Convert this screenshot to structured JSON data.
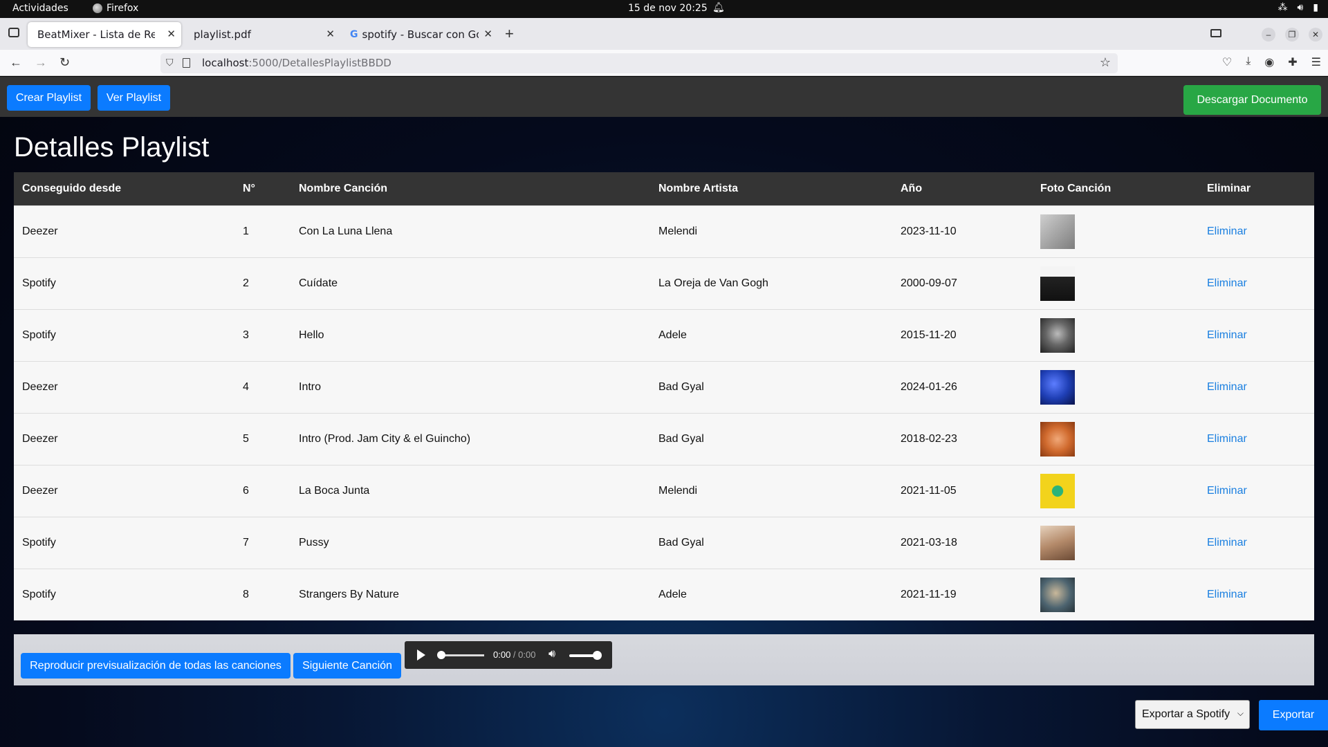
{
  "system_bar": {
    "activities": "Actividades",
    "app": "Firefox",
    "clock": "15 de nov  20:25"
  },
  "browser": {
    "tabs": [
      {
        "title": "BeatMixer - Lista de Reproducción",
        "active": true
      },
      {
        "title": "playlist.pdf",
        "active": false
      },
      {
        "title": "spotify - Buscar con Google",
        "active": false
      }
    ],
    "url_host": "localhost",
    "url_path": ":5000/DetallesPlaylistBBDD"
  },
  "header": {
    "create_label": "Crear Playlist",
    "view_label": "Ver Playlist",
    "download_label": "Descargar Documento"
  },
  "page": {
    "title": "Detalles Playlist"
  },
  "table": {
    "columns": [
      "Conseguido desde",
      "N°",
      "Nombre Canción",
      "Nombre Artista",
      "Año",
      "Foto Canción",
      "Eliminar"
    ],
    "rows": [
      {
        "source": "Deezer",
        "n": "1",
        "song": "Con La Luna Llena",
        "artist": "Melendi",
        "date": "2023-11-10",
        "action": "Eliminar",
        "thumb": "#9a9a9a"
      },
      {
        "source": "Spotify",
        "n": "2",
        "song": "Cuídate",
        "artist": "La Oreja de Van Gogh",
        "date": "2000-09-07",
        "action": "Eliminar",
        "thumb": "#2a2a2a"
      },
      {
        "source": "Spotify",
        "n": "3",
        "song": "Hello",
        "artist": "Adele",
        "date": "2015-11-20",
        "action": "Eliminar",
        "thumb": "#5a5a5a"
      },
      {
        "source": "Deezer",
        "n": "4",
        "song": "Intro",
        "artist": "Bad Gyal",
        "date": "2024-01-26",
        "action": "Eliminar",
        "thumb": "#1f3fb5"
      },
      {
        "source": "Deezer",
        "n": "5",
        "song": "Intro (Prod. Jam City & el Guincho)",
        "artist": "Bad Gyal",
        "date": "2018-02-23",
        "action": "Eliminar",
        "thumb": "#d06a2e"
      },
      {
        "source": "Deezer",
        "n": "6",
        "song": "La Boca Junta",
        "artist": "Melendi",
        "date": "2021-11-05",
        "action": "Eliminar",
        "thumb": "#f2d31c"
      },
      {
        "source": "Spotify",
        "n": "7",
        "song": "Pussy",
        "artist": "Bad Gyal",
        "date": "2021-03-18",
        "action": "Eliminar",
        "thumb": "#b48a6a"
      },
      {
        "source": "Spotify",
        "n": "8",
        "song": "Strangers By Nature",
        "artist": "Adele",
        "date": "2021-11-19",
        "action": "Eliminar",
        "thumb": "#4d6470"
      }
    ]
  },
  "player": {
    "preview_all_label": "Reproducir previsualización de todas las canciones",
    "next_label": "Siguiente Canción",
    "time_current": "0:00",
    "time_sep": " / ",
    "time_total": "0:00"
  },
  "export": {
    "selected_option": "Exportar a Spotify",
    "button_label": "Exportar"
  },
  "colors": {
    "primary": "#0b7bff",
    "success": "#28a745",
    "link": "#1a7fe0",
    "header_bg": "#343434"
  }
}
